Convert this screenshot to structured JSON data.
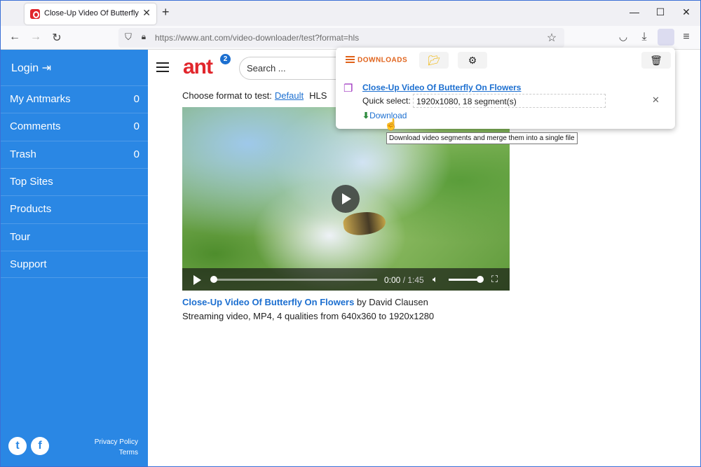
{
  "browser": {
    "tab_title": "Close-Up Video Of Butterfly On Flowers",
    "tab_close": "✕",
    "new_tab": "+",
    "url": "https://www.ant.com/video-downloader/test?format=hls",
    "window_controls": [
      "—",
      "☐",
      "✕"
    ]
  },
  "sidebar": {
    "login_label": "Login",
    "items": [
      {
        "label": "My Antmarks",
        "count": "0"
      },
      {
        "label": "Comments",
        "count": "0"
      },
      {
        "label": "Trash",
        "count": "0"
      },
      {
        "label": "Top Sites",
        "count": ""
      },
      {
        "label": "Products",
        "count": ""
      },
      {
        "label": "Tour",
        "count": ""
      },
      {
        "label": "Support",
        "count": ""
      }
    ],
    "privacy": "Privacy Policy",
    "terms": "Terms"
  },
  "header": {
    "logo": "ant",
    "badge": "2",
    "search_placeholder": "Search ..."
  },
  "page": {
    "choose_label": "Choose format to test:",
    "default_link": "Default",
    "hls_label": "HLS",
    "video_title": "Close-Up Video Of Butterfly On Flowers",
    "author": " by David Clausen",
    "description": "Streaming video, MP4, 4 qualities from 640x360 to 1920x1280",
    "time_current": "0:00",
    "time_duration": " / 1:45"
  },
  "downloads": {
    "tab_label": "DOWNLOADS",
    "item_title": "Close-Up Video Of Butterfly On Flowers",
    "quick_select_label": "Quick select:",
    "quick_select_value": "1920x1080, 18 segment(s)",
    "download_label": "Download",
    "tooltip": "Download video segments and merge them into a single file"
  },
  "colors": {
    "sidebar": "#2a87e4",
    "accent": "#e0621a",
    "link": "#1c6fd0",
    "logo": "#e1262c"
  }
}
